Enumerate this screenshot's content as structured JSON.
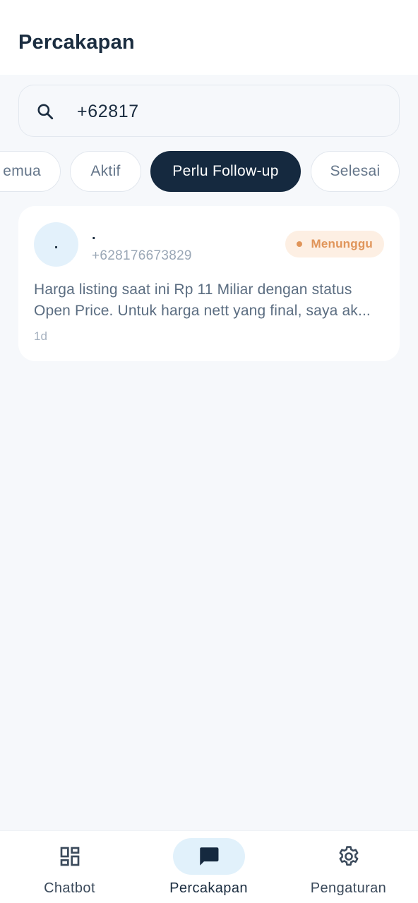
{
  "header": {
    "title": "Percakapan"
  },
  "search": {
    "value": "+62817",
    "icon": "search-icon"
  },
  "filters": [
    {
      "label": "Semua",
      "visible_text": "emua",
      "active": false
    },
    {
      "label": "Aktif",
      "active": false
    },
    {
      "label": "Perlu Follow-up",
      "active": true
    },
    {
      "label": "Selesai",
      "active": false
    }
  ],
  "conversations": [
    {
      "avatar_text": ".",
      "name": ".",
      "phone": "+628176673829",
      "status": "Menunggu",
      "preview_line1": "Harga listing saat ini Rp 11 Miliar dengan status",
      "preview_line2": "Open Price. Untuk harga nett yang final, saya ak...",
      "time": "1d"
    }
  ],
  "nav": [
    {
      "label": "Chatbot",
      "icon": "dashboard-icon",
      "active": false
    },
    {
      "label": "Percakapan",
      "icon": "chat-icon",
      "active": true
    },
    {
      "label": "Pengaturan",
      "icon": "gear-icon",
      "active": false
    }
  ],
  "colors": {
    "primary_dark": "#15293f",
    "background": "#f6f8fb",
    "badge_bg": "#fdefe3",
    "badge_text": "#e0955a",
    "active_nav_bg": "#e1f1fb"
  }
}
